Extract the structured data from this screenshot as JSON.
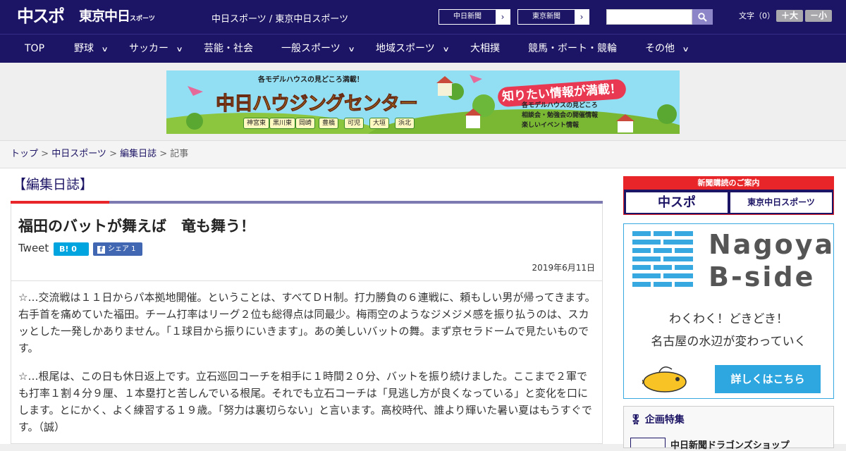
{
  "header": {
    "logo_chunichi_sports": "中スポ",
    "logo_tokyo_chunichi": "東京中日",
    "logo_tokyo_chunichi_small": "スポーツ",
    "site_links": "中日スポーツ / 東京中日スポーツ",
    "paper_buttons": [
      "中日新聞",
      "東京新聞"
    ],
    "search_placeholder": "",
    "font_size_label": "文字（0）",
    "font_bigger": "＋大",
    "font_smaller": "－小"
  },
  "nav": {
    "items": [
      {
        "label": "TOP",
        "has_menu": false
      },
      {
        "label": "野球",
        "has_menu": true
      },
      {
        "label": "サッカー",
        "has_menu": true
      },
      {
        "label": "芸能・社会",
        "has_menu": false
      },
      {
        "label": "一般スポーツ",
        "has_menu": true
      },
      {
        "label": "地域スポーツ",
        "has_menu": true
      },
      {
        "label": "大相撲",
        "has_menu": false
      },
      {
        "label": "競馬・ボート・競輪",
        "has_menu": false
      },
      {
        "label": "その他",
        "has_menu": true
      }
    ]
  },
  "banner": {
    "top_text": "各モデルハウスの見どころ満載！",
    "title": "中日ハウジングセンター",
    "cities": [
      "神宮東",
      "黒川東",
      "岡崎",
      "豊橋",
      "可児",
      "大垣",
      "浜北"
    ],
    "right_title": "知りたい情報が満載！",
    "bullets": [
      "各モデルハウスの見どころ",
      "相談会・勉強会の開催情報",
      "楽しいイベント情報"
    ]
  },
  "breadcrumb": {
    "items": [
      "トップ",
      "中日スポーツ",
      "編集日誌"
    ],
    "current": "記事",
    "separator": " > "
  },
  "category_title": "【編集日誌】",
  "article": {
    "title": "福田のバットが舞えば　竜も舞う！",
    "tweet_label": "Tweet",
    "hatena_label": "B! 0",
    "facebook_label": "シェア 1",
    "date": "2019年6月11日",
    "paragraphs": [
      "☆…交流戦は１１日からパ本拠地開催。ということは、すべてＤＨ制。打力勝負の６連戦に、頼もしい男が帰ってきます。右手首を痛めていた福田。チーム打率はリーグ２位も総得点は同最少。梅雨空のようなジメジメ感を振り払うのは、スカッとした一発しかありません。「１球目から振りにいきます」。あの美しいバットの舞。まず京セラドームで見たいものです。",
      "☆…根尾は、この日も休日返上です。立石巡回コーチを相手に１時間２０分、バットを振り続けました。ここまで２軍でも打率１割４分９厘、１本塁打と苦しんでいる根尾。それでも立石コーチは「見逃し方が良くなっている」と変化を口にします。とにかく、よく練習する１９歳。「努力は裏切らない」と言います。高校時代、誰より輝いた暑い夏はもうすぐです。（誠）"
    ]
  },
  "sidebar": {
    "subscribe_header": "新聞購読のご案内",
    "subscribe_logos": [
      "中スポ",
      "東京中日スポーツ"
    ],
    "ad": {
      "name_line1": "Nagoya",
      "name_line2": "B-side",
      "sub1": "わくわく！どきどき！",
      "sub2": "名古屋の水辺が変わっていく",
      "cta": "詳しくはこちら"
    },
    "feature_header": "企画特集",
    "feature_item": "中日新聞ドラゴンズショップ"
  },
  "colors": {
    "brand_navy": "#1c1464",
    "accent_red": "#e8262a",
    "ad_blue": "#2ea7e0"
  }
}
